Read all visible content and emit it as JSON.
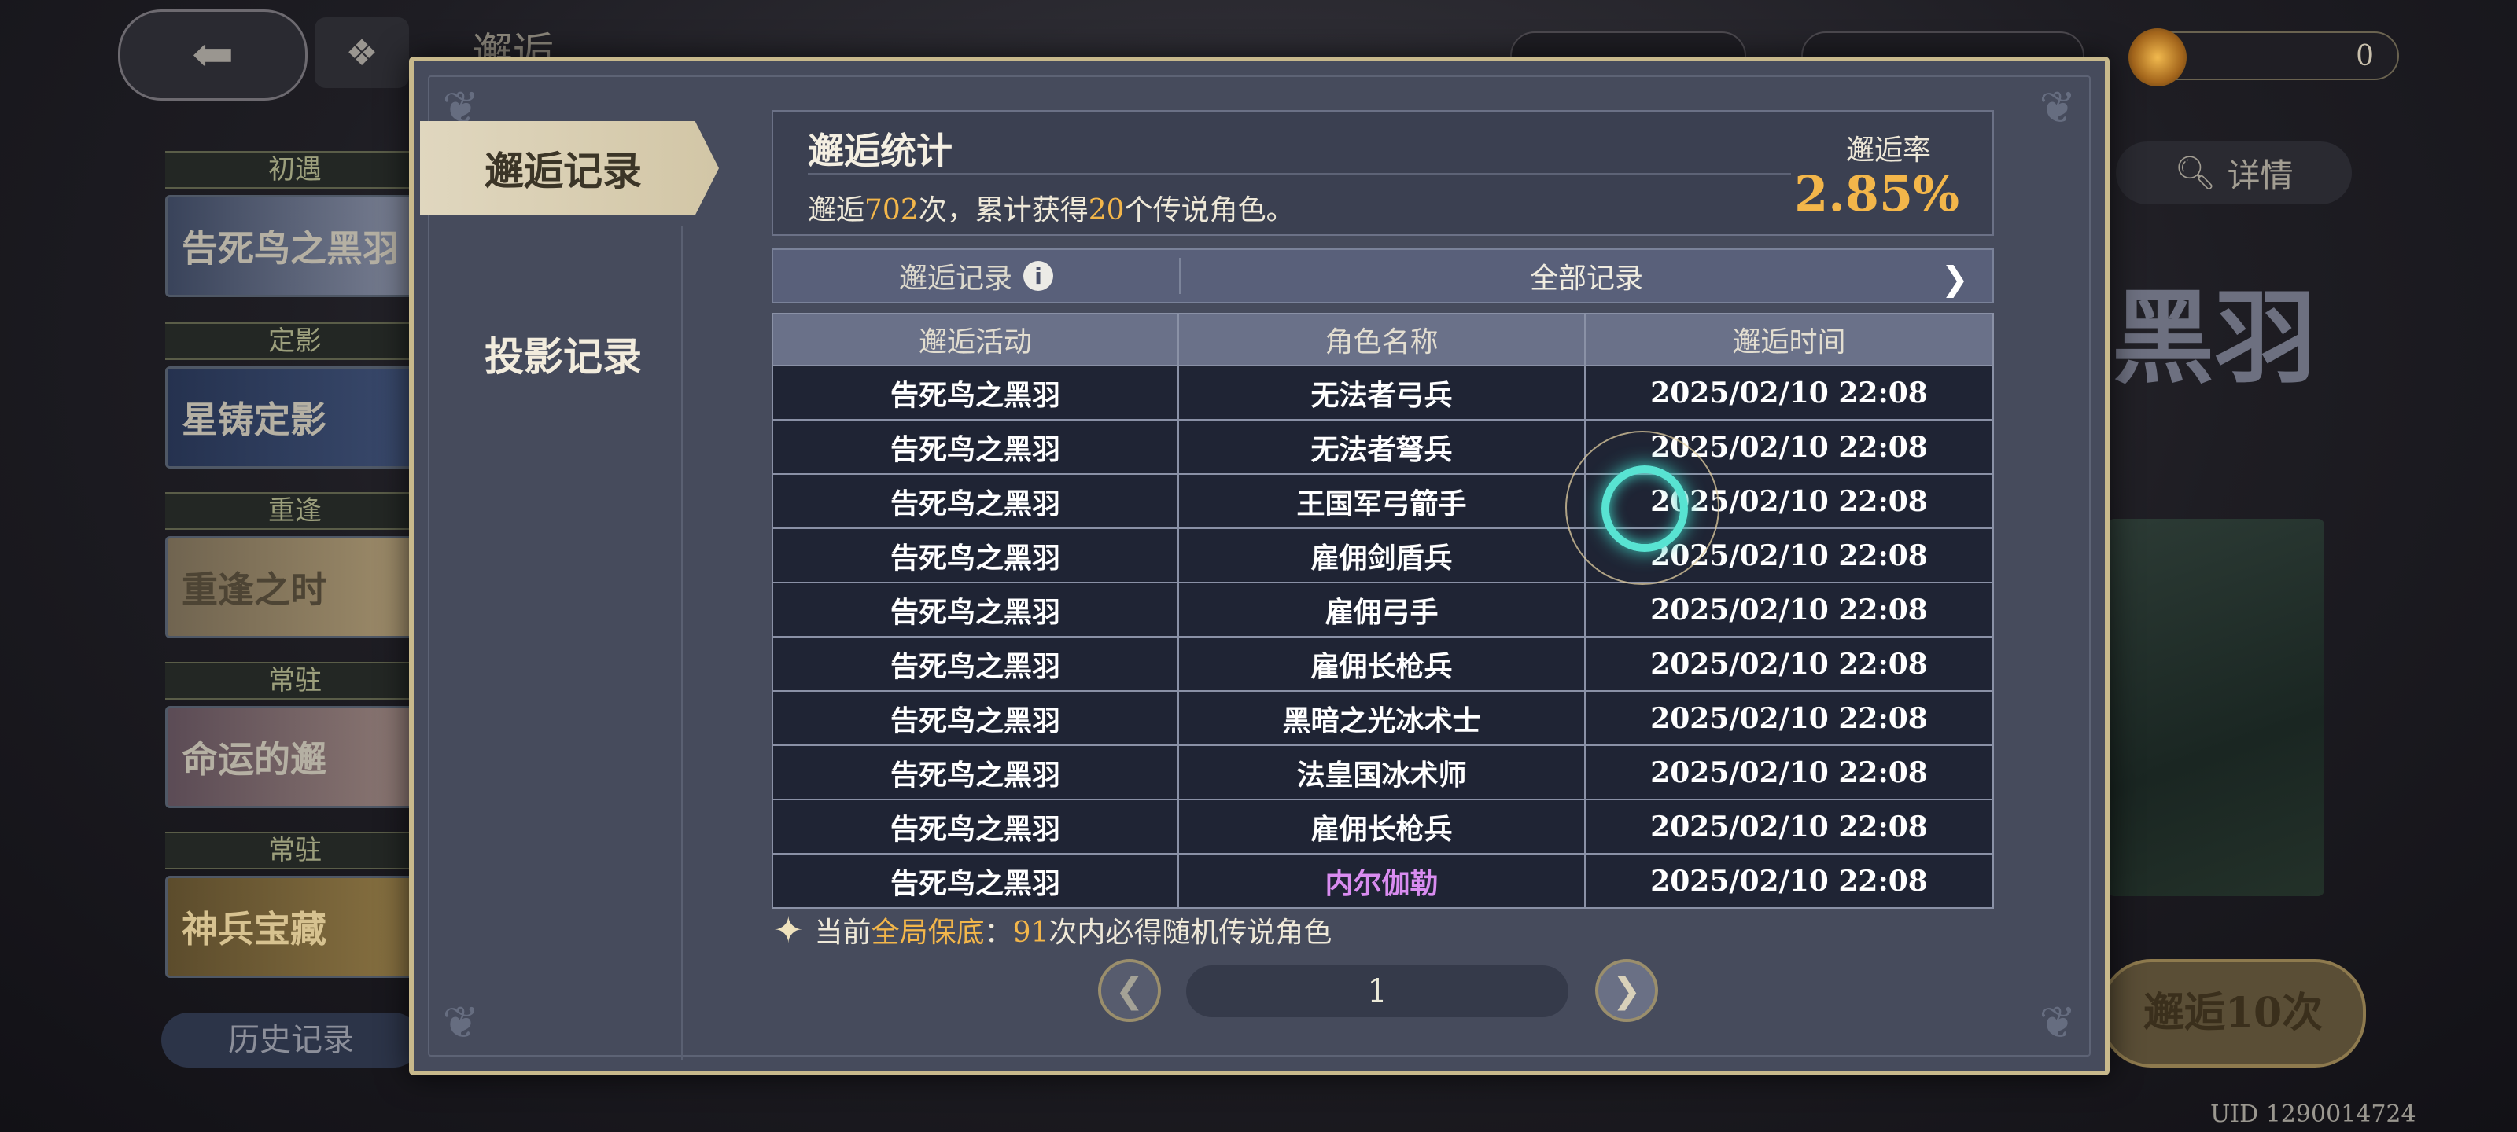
{
  "background": {
    "back_icon": "back-arrow-icon",
    "title": "邂逅",
    "currencies": [
      "0"
    ],
    "side_banners": [
      {
        "tag": "初遇",
        "name": "告死鸟之黑羽"
      },
      {
        "tag": "定影",
        "name": "星铸定影"
      },
      {
        "tag": "重逢",
        "name": "重逢之时"
      },
      {
        "tag": "常驻",
        "name": "命运的邂"
      },
      {
        "tag": "常驻",
        "name": "神兵宝藏"
      }
    ],
    "history_button": "历史记录",
    "detail_button": "详情",
    "banner_art_text": "黑羽",
    "summon_button": "邂逅10次",
    "uid": "UID 1290014724"
  },
  "tabs": [
    {
      "label": "邂逅记录",
      "active": true
    },
    {
      "label": "投影记录",
      "active": false
    }
  ],
  "stats": {
    "title": "邂逅统计",
    "text_prefix": "邂逅",
    "total_pulls": "702",
    "text_mid": "次，累计获得",
    "legend_count": "20",
    "text_suffix": "个传说角色。",
    "rate_label": "邂逅率",
    "rate_value": "2.85%"
  },
  "records_bar": {
    "label": "邂逅记录",
    "filter": "全部记录"
  },
  "table": {
    "headers": [
      "邂逅活动",
      "角色名称",
      "邂逅时间"
    ],
    "rows": [
      {
        "activity": "告死鸟之黑羽",
        "name": "无法者弓兵",
        "time": "2025/02/10 22:08",
        "legendary": false
      },
      {
        "activity": "告死鸟之黑羽",
        "name": "无法者弩兵",
        "time": "2025/02/10 22:08",
        "legendary": false
      },
      {
        "activity": "告死鸟之黑羽",
        "name": "王国军弓箭手",
        "time": "2025/02/10 22:08",
        "legendary": false
      },
      {
        "activity": "告死鸟之黑羽",
        "name": "雇佣剑盾兵",
        "time": "2025/02/10 22:08",
        "legendary": false
      },
      {
        "activity": "告死鸟之黑羽",
        "name": "雇佣弓手",
        "time": "2025/02/10 22:08",
        "legendary": false
      },
      {
        "activity": "告死鸟之黑羽",
        "name": "雇佣长枪兵",
        "time": "2025/02/10 22:08",
        "legendary": false
      },
      {
        "activity": "告死鸟之黑羽",
        "name": "黑暗之光冰术士",
        "time": "2025/02/10 22:08",
        "legendary": false
      },
      {
        "activity": "告死鸟之黑羽",
        "name": "法皇国冰术师",
        "time": "2025/02/10 22:08",
        "legendary": false
      },
      {
        "activity": "告死鸟之黑羽",
        "name": "雇佣长枪兵",
        "time": "2025/02/10 22:08",
        "legendary": false
      },
      {
        "activity": "告死鸟之黑羽",
        "name": "内尔伽勒",
        "time": "2025/02/10 22:08",
        "legendary": true
      }
    ]
  },
  "guarantee": {
    "prefix": "当前",
    "highlight": "全局保底",
    "colon": "：",
    "count": "91",
    "suffix": "次内必得随机传说角色"
  },
  "pager": {
    "page": "1"
  },
  "colors": {
    "accent_gold": "#f3b64a",
    "legendary_purple": "#d98cf0",
    "tap_cyan": "#58e3d2"
  }
}
